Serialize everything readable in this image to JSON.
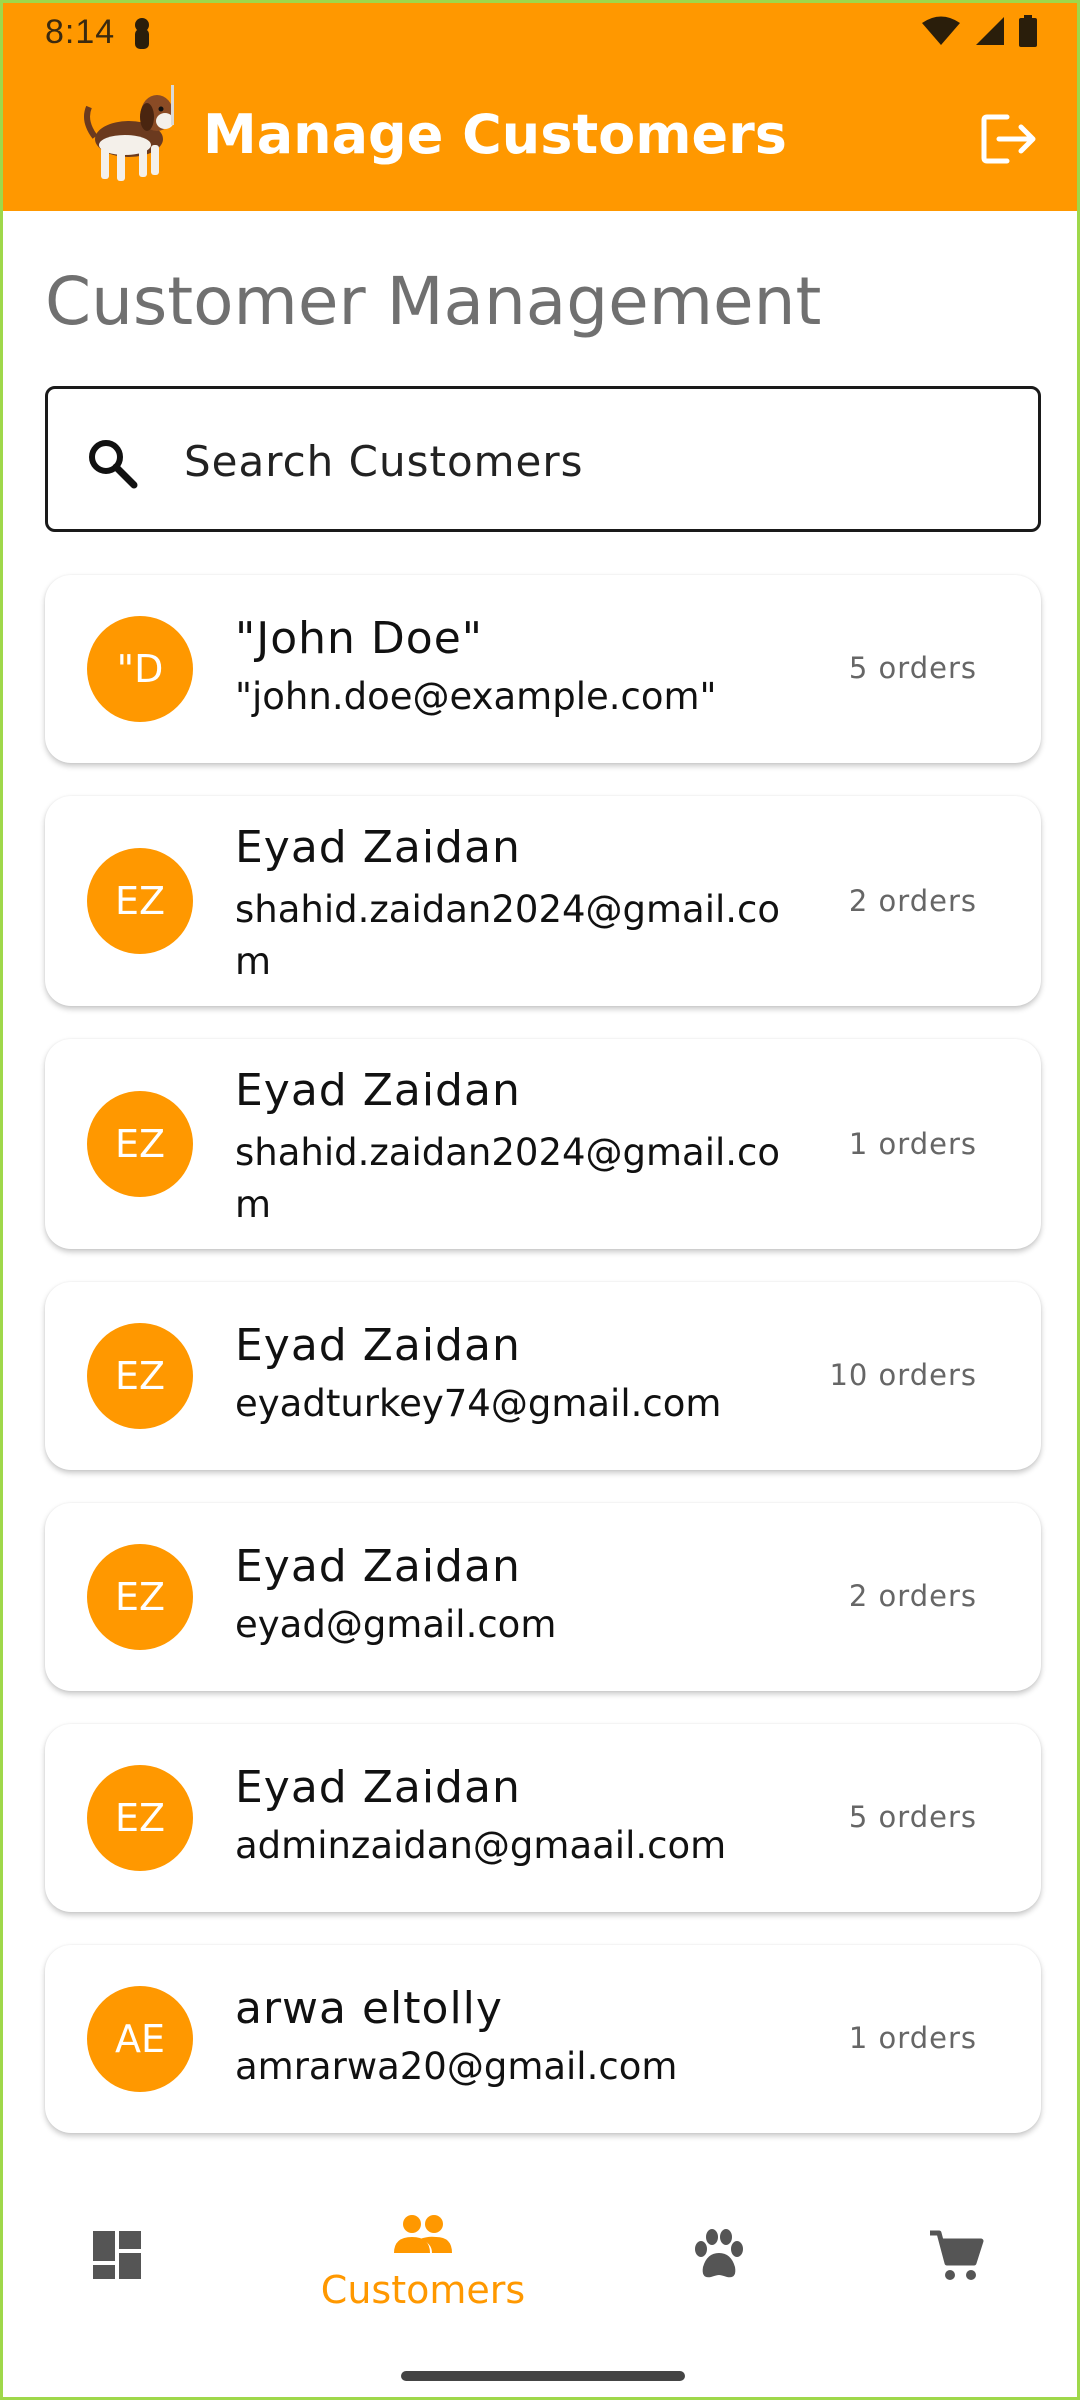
{
  "status_bar": {
    "time": "8:14"
  },
  "app_bar": {
    "title": "Manage Customers"
  },
  "page": {
    "title": "Customer Management"
  },
  "search": {
    "placeholder": "Search Customers"
  },
  "customers": [
    {
      "initials": "\"D",
      "name": "\"John Doe\"",
      "email": "\"john.doe@example.com\"",
      "orders": "5 orders"
    },
    {
      "initials": "EZ",
      "name": "Eyad Zaidan",
      "email": "shahid.zaidan2024@gmail.com",
      "orders": "2 orders"
    },
    {
      "initials": "EZ",
      "name": "Eyad Zaidan",
      "email": "shahid.zaidan2024@gmail.com",
      "orders": "1 orders"
    },
    {
      "initials": "EZ",
      "name": "Eyad Zaidan",
      "email": "eyadturkey74@gmail.com",
      "orders": "10 orders"
    },
    {
      "initials": "EZ",
      "name": "Eyad Zaidan",
      "email": "eyad@gmail.com",
      "orders": "2 orders"
    },
    {
      "initials": "EZ",
      "name": "Eyad Zaidan",
      "email": "adminzaidan@gmaail.com",
      "orders": "5 orders"
    },
    {
      "initials": "AE",
      "name": "arwa eltolly",
      "email": "amrarwa20@gmail.com",
      "orders": "1 orders"
    }
  ],
  "bottom_nav": {
    "items": [
      {
        "icon": "dashboard-icon",
        "label": ""
      },
      {
        "icon": "people-icon",
        "label": "Customers",
        "active": true
      },
      {
        "icon": "paw-icon",
        "label": ""
      },
      {
        "icon": "cart-icon",
        "label": ""
      }
    ]
  },
  "colors": {
    "accent": "#ff9800",
    "text": "#111111",
    "muted": "#707070"
  }
}
